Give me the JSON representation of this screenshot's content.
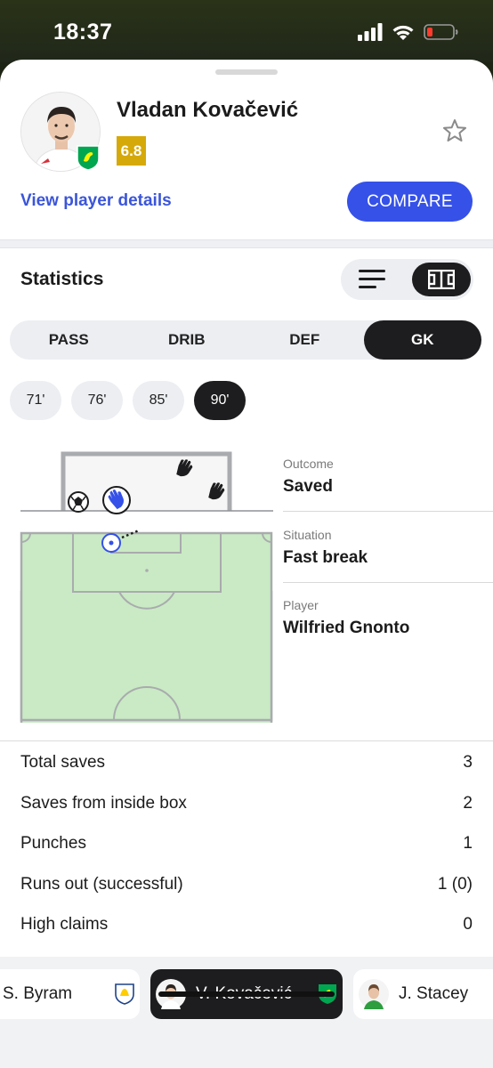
{
  "status_bar": {
    "time": "18:37"
  },
  "player": {
    "name": "Vladan Kovačević",
    "rating": "6.8",
    "view_details": "View player details",
    "compare": "COMPARE"
  },
  "statistics": {
    "title": "Statistics",
    "tabs": [
      {
        "label": "PASS",
        "active": false
      },
      {
        "label": "DRIB",
        "active": false
      },
      {
        "label": "DEF",
        "active": false
      },
      {
        "label": "GK",
        "active": true
      }
    ],
    "minutes": [
      {
        "label": "71'",
        "active": false
      },
      {
        "label": "76'",
        "active": false
      },
      {
        "label": "85'",
        "active": false
      },
      {
        "label": "90'",
        "active": true
      }
    ]
  },
  "event": {
    "outcome_label": "Outcome",
    "outcome_value": "Saved",
    "situation_label": "Situation",
    "situation_value": "Fast break",
    "player_label": "Player",
    "player_value": "Wilfried Gnonto"
  },
  "stats": [
    {
      "label": "Total saves",
      "value": "3"
    },
    {
      "label": "Saves from inside box",
      "value": "2"
    },
    {
      "label": "Punches",
      "value": "1"
    },
    {
      "label": "Runs out (successful)",
      "value": "1 (0)"
    },
    {
      "label": "High claims",
      "value": "0"
    }
  ],
  "player_strip": [
    {
      "name": "S. Byram",
      "active": false
    },
    {
      "name": "V. Kovačević",
      "active": true
    },
    {
      "name": "J. Stacey",
      "active": false
    }
  ],
  "icons": {
    "signal": "cellular-signal-icon",
    "wifi": "wifi-icon",
    "battery": "battery-low-icon",
    "favorite": "star-outline-icon",
    "list_view": "list-view-icon",
    "pitch_view": "pitch-view-icon"
  },
  "colors": {
    "accent": "#3551e8",
    "rating": "#d6a90a",
    "pitch": "#c9eac4",
    "active_chip": "#1d1d1f"
  }
}
